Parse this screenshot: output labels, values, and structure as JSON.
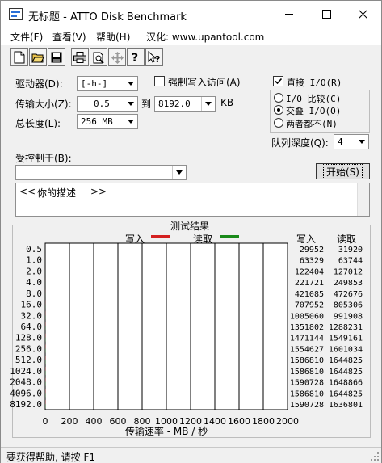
{
  "window": {
    "title": "无标题 - ATTO Disk Benchmark"
  },
  "menu": {
    "items": [
      "文件(F)",
      "查看(V)",
      "帮助(H)",
      "汉化: www.upantool.com"
    ]
  },
  "toolbar": {
    "buttons": [
      "new-file-icon",
      "open-folder-icon",
      "save-icon",
      "print-icon",
      "print-preview-icon",
      "move-icon",
      "help-icon",
      "context-help-icon"
    ]
  },
  "settings": {
    "drive_label": "驱动器(D):",
    "drive_value": "[-h-]",
    "force_write_label": "强制写入访问(A)",
    "transfer_size_label": "传输大小(Z):",
    "transfer_from": "0.5",
    "to_label": "到",
    "transfer_to": "8192.0",
    "kb_label": "KB",
    "total_length_label": "总长度(L):",
    "total_length_value": "256 MB",
    "direct_io_label": "直接 I/O(R)",
    "direct_io_checked": true,
    "io_compare_label": "I/O 比较(C)",
    "overlapped_io_label": "交叠 I/O(O)",
    "neither_label": "两者都不(N)",
    "selected_mode": "overlapped",
    "queue_depth_label": "队列深度(Q):",
    "queue_depth_value": "4",
    "controlled_by_label": "受控制于(B):",
    "controlled_by_value": "",
    "start_button": "开始(S)",
    "description_open": "<<",
    "description_text": "你的描述",
    "description_close": ">>"
  },
  "results": {
    "title": "测试结果",
    "write_legend": "写入",
    "read_legend": "读取",
    "write_header": "写入",
    "read_header": "读取",
    "colors": {
      "write": "#d42020",
      "read": "#1a8a1a"
    }
  },
  "chart_data": {
    "type": "bar",
    "orientation": "horizontal",
    "categories": [
      "0.5",
      "1.0",
      "2.0",
      "4.0",
      "8.0",
      "16.0",
      "32.0",
      "64.0",
      "128.0",
      "256.0",
      "512.0",
      "1024.0",
      "2048.0",
      "4096.0",
      "8192.0"
    ],
    "series": [
      {
        "name": "写入",
        "values": [
          29952,
          63329,
          122404,
          221721,
          421085,
          707952,
          1005060,
          1351802,
          1471144,
          1554627,
          1586810,
          1586810,
          1590728,
          1586810,
          1590728
        ]
      },
      {
        "name": "读取",
        "values": [
          31920,
          63744,
          127012,
          249853,
          472676,
          805306,
          991908,
          1288231,
          1549161,
          1601034,
          1644825,
          1644825,
          1648866,
          1644825,
          1636801
        ]
      }
    ],
    "write_labels": [
      "29952",
      "63329",
      "122404",
      "221721",
      "421085",
      "707952",
      "1005060",
      "1351802",
      "1471144",
      "1554627",
      "1586810",
      "1586810",
      "1590728",
      "1586810",
      "1590728"
    ],
    "read_labels": [
      "31920",
      "63744",
      "127012",
      "249853",
      "472676",
      "805306",
      "991908",
      "1288231",
      "1549161",
      "1601034",
      "1644825",
      "1644825",
      "1648866",
      "1644825",
      "1636801"
    ],
    "x_ticks": [
      "0",
      "200",
      "400",
      "600",
      "800",
      "1000",
      "1200",
      "1400",
      "1600",
      "1800",
      "2000"
    ],
    "xlim": [
      0,
      2000
    ],
    "xlabel": "传输速率 - MB / 秒",
    "grid": true
  },
  "status": {
    "text": "要获得帮助, 请按 F1"
  }
}
